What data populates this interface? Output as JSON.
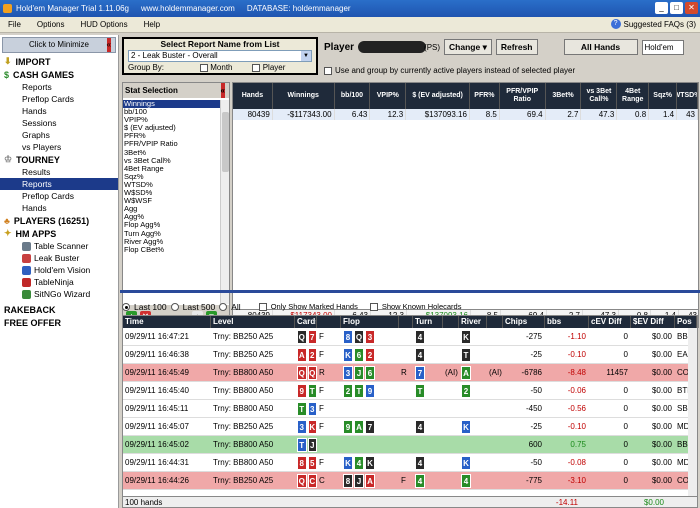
{
  "titlebar": {
    "app": "Hold'em Manager Trial 1.11.06g",
    "site": "www.holdemmanager.com",
    "database": "DATABASE: holdemmanager"
  },
  "menu": {
    "items": [
      "File",
      "Options",
      "HUD Options",
      "Help"
    ],
    "faq": "Suggested FAQs (3)"
  },
  "sidebar": {
    "minimize": "Click to Minimize",
    "import": "IMPORT",
    "cash": "CASH GAMES",
    "cash_items": [
      "Reports",
      "Preflop Cards",
      "Hands",
      "Sessions",
      "Graphs",
      "vs Players"
    ],
    "tourney": "TOURNEY",
    "tourney_items": [
      "Results",
      "Reports",
      "Preflop Cards",
      "Hands"
    ],
    "players": "PLAYERS (16251)",
    "hmapps": "HM APPS",
    "apps": [
      "Table Scanner",
      "Leak Buster",
      "Hold'em Vision",
      "TableNinja",
      "SitNGo Wizard"
    ],
    "rakeback": "RAKEBACK",
    "freeoffer": "FREE OFFER"
  },
  "report": {
    "header": "Select Report Name from List",
    "selected": "2 - Leak Buster - Overall",
    "groupby": "Group By:",
    "month": "Month",
    "player": "Player"
  },
  "playerbar": {
    "label": "Player",
    "suffix": "(PS)",
    "change": "Change",
    "refresh": "Refresh",
    "allhands": "All Hands",
    "game": "Hold'em",
    "usegroup": "Use and group by currently active players instead of selected player"
  },
  "stats": {
    "header": "Stat Selection",
    "items": [
      "Winnings",
      "bb/100",
      "VPIP%",
      "$ (EV adjusted)",
      "PFR%",
      "PFR/VPIP Ratio",
      "3Bet%",
      "vs 3Bet Call%",
      "4Bet Range",
      "Sqz%",
      "WTSD%",
      "W$SD%",
      "W$WSF",
      "Agg",
      "Agg%",
      "Flop Agg%",
      "Turn Agg%",
      "River Agg%",
      "Flop CBet%"
    ]
  },
  "report_table": {
    "headers": [
      "Hands",
      "Winnings",
      "bb/100",
      "VPIP%",
      "$ (EV adjusted)",
      "PFR%",
      "PFR/VPIP Ratio",
      "3Bet%",
      "vs 3Bet Call%",
      "4Bet Range",
      "Sqz%",
      "WTSD%"
    ],
    "row": [
      "80439",
      "-$117343.00",
      "6.43",
      "12.3",
      "$137093.16",
      "8.5",
      "69.4",
      "2.7",
      "47.3",
      "0.8",
      "1.4",
      "43"
    ],
    "total": [
      "80439",
      "-$117343.00",
      "6.43",
      "12.3",
      "$137093.16",
      "8.5",
      "69.4",
      "2.7",
      "47.3",
      "0.8",
      "1.4",
      "43"
    ]
  },
  "handsbar": {
    "last100": "Last 100",
    "last500": "Last 500",
    "all": "All",
    "marked": "Only Show Marked Hands",
    "known": "Show Known Holecards"
  },
  "hands": {
    "headers": [
      "Time",
      "Level",
      "Cards",
      "",
      "Flop",
      "",
      "Turn",
      "",
      "River",
      "",
      "Chips",
      "bbs",
      "cEV Diff",
      "$EV Diff",
      "Pos"
    ],
    "rows": [
      {
        "time": "09/29/11 16:47:21",
        "level": "Trny: BB250 A25",
        "cards": [
          [
            "Q",
            "s"
          ],
          [
            "7",
            "h"
          ]
        ],
        "pa": "F",
        "flop": [
          [
            "8",
            "d"
          ],
          [
            "Q",
            "s"
          ],
          [
            "3",
            "h"
          ]
        ],
        "fa": "",
        "turn": [
          [
            "4",
            "s"
          ]
        ],
        "ta": "",
        "river": [
          [
            "K",
            "s"
          ]
        ],
        "ra": "",
        "chips": "-275",
        "bbs": "-1.10",
        "cev": "0",
        "ev": "$0.00",
        "pos": "BB",
        "style": ""
      },
      {
        "time": "09/29/11 16:46:38",
        "level": "Trny: BB250 A25",
        "cards": [
          [
            "A",
            "h"
          ],
          [
            "2",
            "h"
          ]
        ],
        "pa": "F",
        "flop": [
          [
            "K",
            "d"
          ],
          [
            "6",
            "c"
          ],
          [
            "2",
            "h"
          ]
        ],
        "fa": "",
        "turn": [
          [
            "4",
            "s"
          ]
        ],
        "ta": "",
        "river": [
          [
            "T",
            "s"
          ]
        ],
        "ra": "",
        "chips": "-25",
        "bbs": "-0.10",
        "cev": "0",
        "ev": "$0.00",
        "pos": "EA",
        "style": ""
      },
      {
        "time": "09/29/11 16:45:49",
        "level": "Trny: BB800 A50",
        "cards": [
          [
            "Q",
            "h"
          ],
          [
            "Q",
            "h"
          ]
        ],
        "pa": "R",
        "flop": [
          [
            "3",
            "d"
          ],
          [
            "J",
            "c"
          ],
          [
            "6",
            "c"
          ]
        ],
        "fa": "R",
        "turn": [
          [
            "7",
            "d"
          ]
        ],
        "ta": "(AI)",
        "river": [
          [
            "A",
            "c"
          ]
        ],
        "ra": "(AI)",
        "chips": "-6786",
        "bbs": "-8.48",
        "cev": "11457",
        "ev": "$0.00",
        "pos": "CO",
        "style": "red"
      },
      {
        "time": "09/29/11 16:45:40",
        "level": "Trny: BB800 A50",
        "cards": [
          [
            "9",
            "h"
          ],
          [
            "T",
            "c"
          ]
        ],
        "pa": "F",
        "flop": [
          [
            "2",
            "c"
          ],
          [
            "T",
            "c"
          ],
          [
            "9",
            "d"
          ]
        ],
        "fa": "",
        "turn": [
          [
            "T",
            "c"
          ]
        ],
        "ta": "",
        "river": [
          [
            "2",
            "c"
          ]
        ],
        "ra": "",
        "chips": "-50",
        "bbs": "-0.06",
        "cev": "0",
        "ev": "$0.00",
        "pos": "BTN",
        "style": ""
      },
      {
        "time": "09/29/11 16:45:11",
        "level": "Trny: BB800 A50",
        "cards": [
          [
            "T",
            "c"
          ],
          [
            "3",
            "d"
          ]
        ],
        "pa": "F",
        "flop": [],
        "fa": "",
        "turn": [],
        "ta": "",
        "river": [],
        "ra": "",
        "chips": "-450",
        "bbs": "-0.56",
        "cev": "0",
        "ev": "$0.00",
        "pos": "SB",
        "style": ""
      },
      {
        "time": "09/29/11 16:45:07",
        "level": "Trny: BB250 A25",
        "cards": [
          [
            "3",
            "d"
          ],
          [
            "K",
            "h"
          ]
        ],
        "pa": "F",
        "flop": [
          [
            "9",
            "c"
          ],
          [
            "A",
            "c"
          ],
          [
            "7",
            "s"
          ]
        ],
        "fa": "",
        "turn": [
          [
            "4",
            "s"
          ]
        ],
        "ta": "",
        "river": [
          [
            "K",
            "d"
          ]
        ],
        "ra": "",
        "chips": "-25",
        "bbs": "-0.10",
        "cev": "0",
        "ev": "$0.00",
        "pos": "MD",
        "style": ""
      },
      {
        "time": "09/29/11 16:45:02",
        "level": "Trny: BB800 A50",
        "cards": [
          [
            "T",
            "d"
          ],
          [
            "J",
            "s"
          ]
        ],
        "pa": "",
        "flop": [],
        "fa": "",
        "turn": [],
        "ta": "",
        "river": [],
        "ra": "",
        "chips": "600",
        "bbs": "0.75",
        "cev": "0",
        "ev": "$0.00",
        "pos": "BB",
        "style": "green"
      },
      {
        "time": "09/29/11 16:44:31",
        "level": "Trny: BB800 A50",
        "cards": [
          [
            "8",
            "h"
          ],
          [
            "5",
            "h"
          ]
        ],
        "pa": "F",
        "flop": [
          [
            "K",
            "d"
          ],
          [
            "4",
            "c"
          ],
          [
            "K",
            "s"
          ]
        ],
        "fa": "",
        "turn": [
          [
            "4",
            "s"
          ]
        ],
        "ta": "",
        "river": [
          [
            "K",
            "d"
          ]
        ],
        "ra": "",
        "chips": "-50",
        "bbs": "-0.08",
        "cev": "0",
        "ev": "$0.00",
        "pos": "MD",
        "style": ""
      },
      {
        "time": "09/29/11 16:44:26",
        "level": "Trny: BB250 A25",
        "cards": [
          [
            "Q",
            "h"
          ],
          [
            "C",
            "h"
          ]
        ],
        "pa": "C",
        "flop": [
          [
            "8",
            "s"
          ],
          [
            "J",
            "s"
          ],
          [
            "A",
            "h"
          ]
        ],
        "fa": "F",
        "turn": [
          [
            "4",
            "c"
          ]
        ],
        "ta": "",
        "river": [
          [
            "4",
            "c"
          ]
        ],
        "ra": "",
        "chips": "-775",
        "bbs": "-3.10",
        "cev": "0",
        "ev": "$0.00",
        "pos": "CO",
        "style": "red"
      }
    ],
    "footer": {
      "count": "100 hands",
      "bbs": "-14.11",
      "ev": "$0.00"
    }
  }
}
